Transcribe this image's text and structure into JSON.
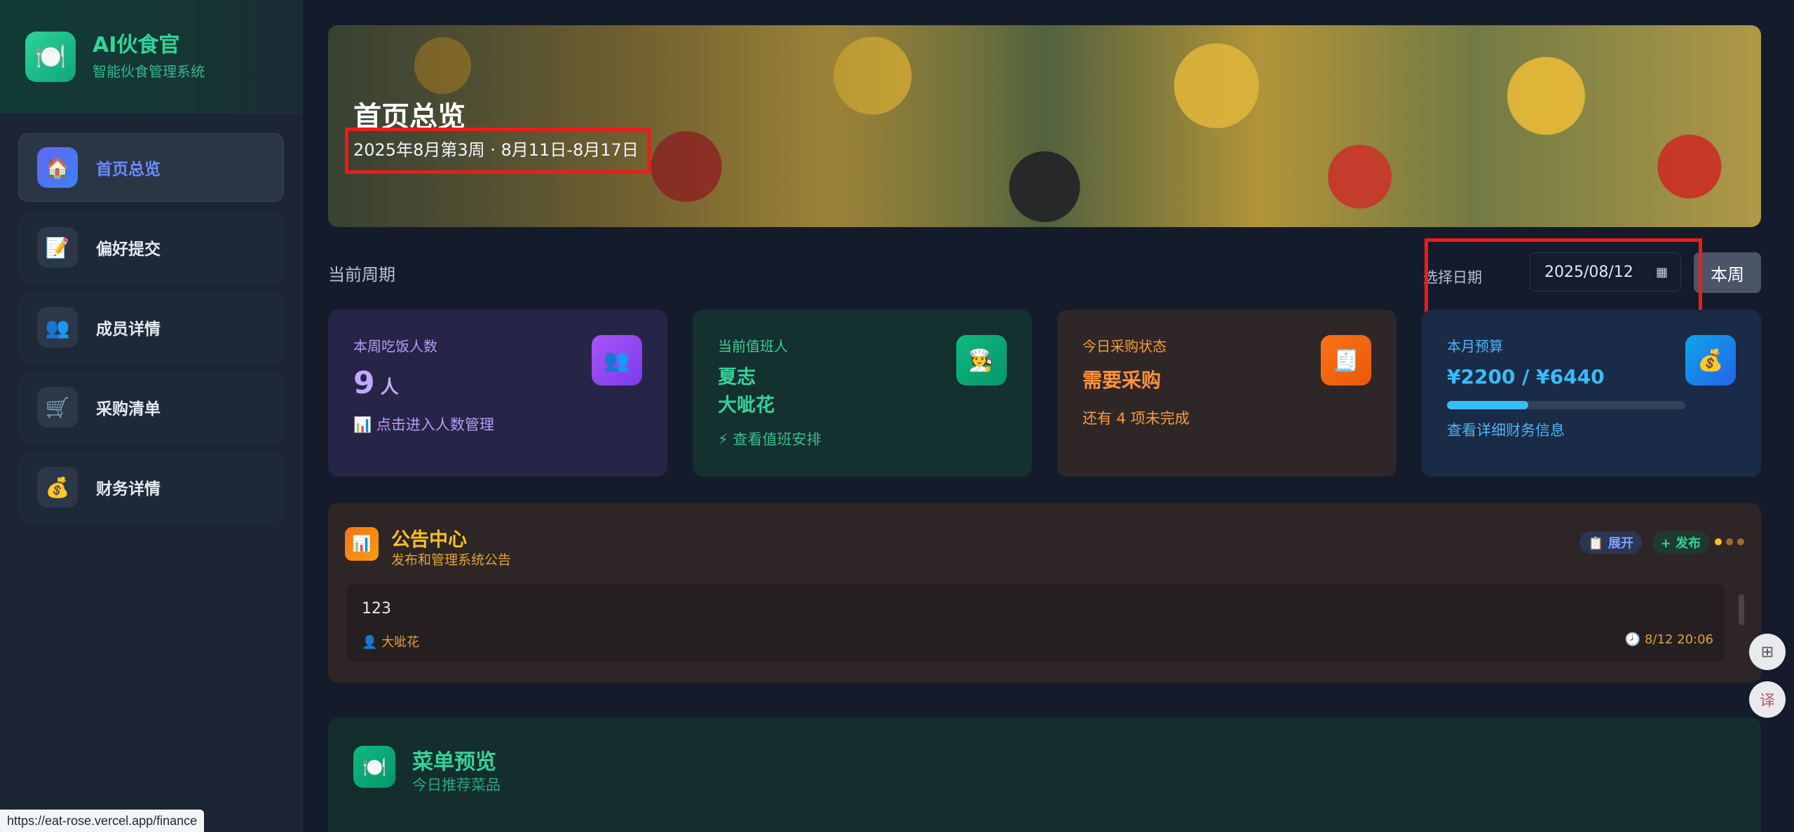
{
  "brand": {
    "title": "AI伙食官",
    "subtitle": "智能伙食管理系统",
    "logo_icon": "🍽️"
  },
  "sidebar": {
    "items": [
      {
        "label": "首页总览",
        "icon": "🏠",
        "active": true
      },
      {
        "label": "偏好提交",
        "icon": "📝",
        "active": false
      },
      {
        "label": "成员详情",
        "icon": "👥",
        "active": false
      },
      {
        "label": "采购清单",
        "icon": "🛒",
        "active": false
      },
      {
        "label": "财务详情",
        "icon": "💰",
        "active": false
      }
    ]
  },
  "hero": {
    "title": "首页总览",
    "subtitle": "2025年8月第3周 · 8月11日-8月17日"
  },
  "period": {
    "label": "当前周期",
    "date_label": "选择日期",
    "date_value": "2025/08/12",
    "week_button": "本周"
  },
  "cards": {
    "diners": {
      "title": "本周吃饭人数",
      "value": "9",
      "unit": "人",
      "link": "点击进入人数管理",
      "icon": "👥"
    },
    "duty": {
      "title": "当前值班人",
      "names": [
        "夏志",
        "大呲花"
      ],
      "link": "查看值班安排",
      "icon": "🧑‍🍳"
    },
    "purchase": {
      "title": "今日采购状态",
      "status": "需要采购",
      "note": "还有 4 项未完成",
      "icon": "🧾"
    },
    "budget": {
      "title": "本月预算",
      "amount": "¥2200 / ¥6440",
      "progress": 0.34,
      "link": "查看详细财务信息",
      "icon": "💰"
    }
  },
  "notice": {
    "title": "公告中心",
    "subtitle": "发布和管理系统公告",
    "expand_label": "📋 展开",
    "publish_label": "+ 发布",
    "items": [
      {
        "text": "123",
        "author": "大呲花",
        "time": "8/12 20:06"
      }
    ]
  },
  "menu": {
    "title": "菜单预览",
    "subtitle": "今日推荐菜品",
    "icon": "🍽️"
  },
  "status_url": "https://eat-rose.vercel.app/finance",
  "colors": {
    "accent": "#34d399",
    "highlight": "#ef1b1b",
    "active_nav": "#6c8cff"
  }
}
